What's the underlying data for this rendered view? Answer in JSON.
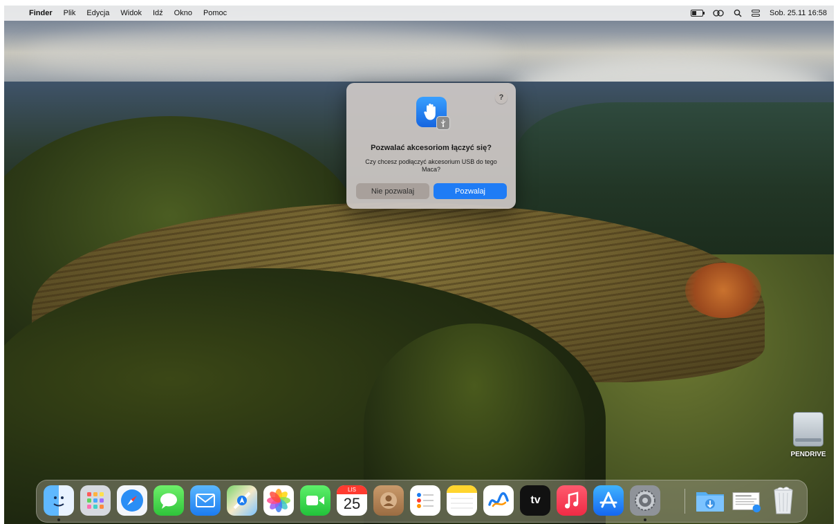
{
  "menubar": {
    "app": "Finder",
    "items": [
      "Plik",
      "Edycja",
      "Widok",
      "Idź",
      "Okno",
      "Pomoc"
    ],
    "clock": "Sob. 25.11  16:58",
    "battery_level": 0.4,
    "status_icons": [
      "battery-icon",
      "screen-mirroring-icon",
      "spotlight-search-icon",
      "control-center-icon"
    ]
  },
  "dialog": {
    "help": "?",
    "title": "Pozwalać akcesoriom łączyć się?",
    "message": "Czy chcesz podłączyć akcesorium USB do tego Maca?",
    "deny_label": "Nie pozwalaj",
    "allow_label": "Pozwalaj",
    "accent": "#1f7cf5"
  },
  "desktop": {
    "drive_label": "PENDRIVE"
  },
  "dock": {
    "apps": [
      "Finder",
      "Launchpad",
      "Safari",
      "Wiadomości",
      "Mail",
      "Mapy",
      "Zdjęcia",
      "FaceTime",
      "Kalendarz",
      "Kontakty",
      "Przypomnienia",
      "Notatki",
      "Freeform",
      "TV",
      "Muzyka",
      "App Store",
      "Ustawienia systemowe",
      "Pobrane",
      "Dokument",
      "Kosz"
    ],
    "calendar_month": "LIS",
    "calendar_day": "25",
    "tv_label": "tv"
  }
}
